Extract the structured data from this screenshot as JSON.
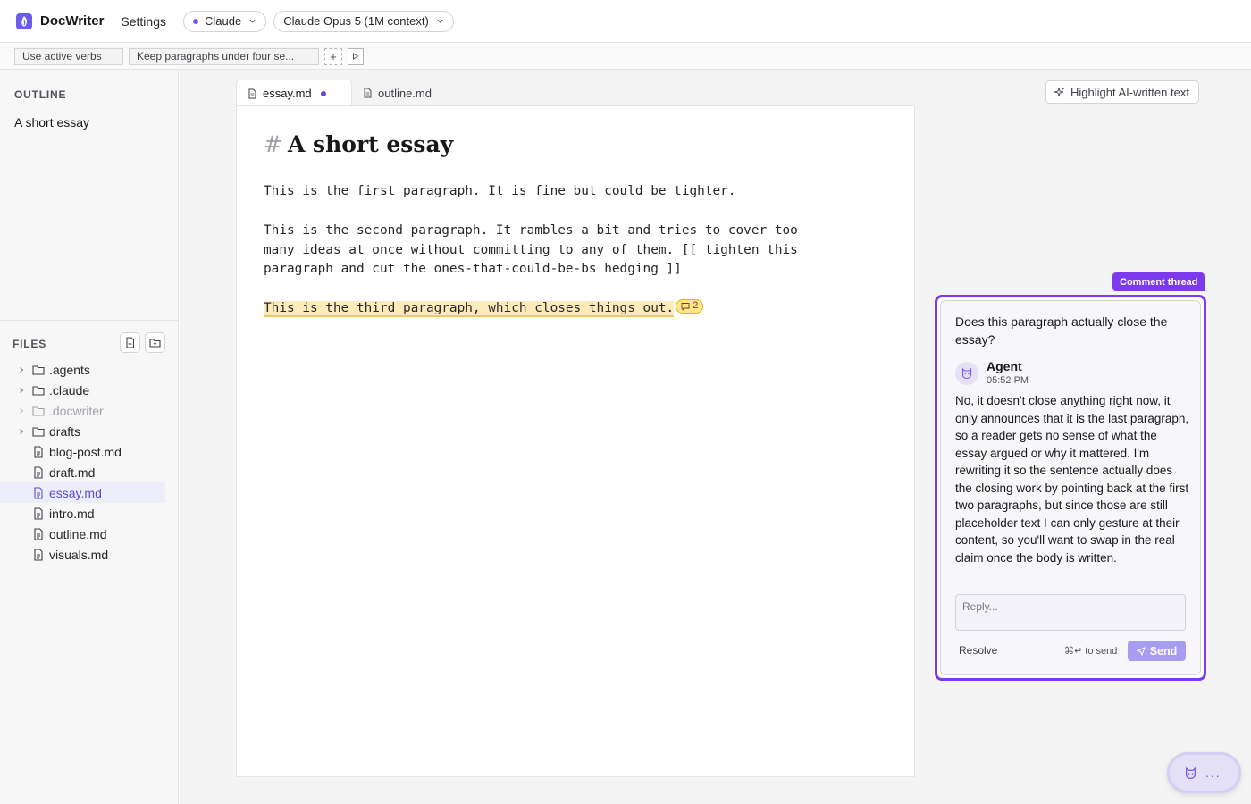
{
  "app": {
    "title": "DocWriter",
    "settings_label": "Settings",
    "provider_label": "Claude",
    "model_label": "Claude Opus 5 (1M context)",
    "accent_color": "#7c3aed"
  },
  "rules": {
    "items": [
      {
        "label": "Use active verbs"
      },
      {
        "label": "Keep paragraphs under four se..."
      }
    ],
    "add_label": "+"
  },
  "sidebar": {
    "outline_title": "OUTLINE",
    "outline_items": [
      {
        "label": "A short essay"
      }
    ],
    "files_title": "FILES",
    "tree": [
      {
        "name": ".agents",
        "type": "folder"
      },
      {
        "name": ".claude",
        "type": "folder"
      },
      {
        "name": ".docwriter",
        "type": "folder",
        "muted": true
      },
      {
        "name": "drafts",
        "type": "folder"
      },
      {
        "name": "blog-post.md",
        "type": "file"
      },
      {
        "name": "draft.md",
        "type": "file"
      },
      {
        "name": "essay.md",
        "type": "file",
        "active": true
      },
      {
        "name": "intro.md",
        "type": "file"
      },
      {
        "name": "outline.md",
        "type": "file"
      },
      {
        "name": "visuals.md",
        "type": "file"
      }
    ]
  },
  "tabs": [
    {
      "label": "essay.md",
      "active": true,
      "modified": true
    },
    {
      "label": "outline.md",
      "active": false
    }
  ],
  "highlight_button_label": "Highlight AI-written text",
  "document": {
    "heading_marker": "#",
    "heading": "A short essay",
    "paragraphs": [
      "This is the first paragraph. It is fine but could be tighter.",
      "This is the second paragraph. It rambles a bit and tries to cover too many ideas at once without committing to any of them. [[ tighten this paragraph and cut the ones-that-could-be-bs hedging ]]",
      "This is the third paragraph, which closes things out."
    ],
    "comment_count": "2"
  },
  "comment_thread": {
    "label": "Comment thread",
    "question": "Does this paragraph actually close the essay?",
    "agent_name": "Agent",
    "agent_time": "05:52 PM",
    "agent_message": "No, it doesn't close anything right now, it only announces that it is the last paragraph, so a reader gets no sense of what the essay argued or why it mattered. I'm rewriting it so the sentence actually does the closing work by pointing back at the first two paragraphs, but since those are still placeholder text I can only gesture at their content, so you'll want to swap in the real claim once the body is written.",
    "reply_placeholder": "Reply...",
    "resolve_label": "Resolve",
    "send_hint": "⌘↵ to send",
    "send_label": "Send"
  },
  "fab": {
    "dots": "..."
  }
}
